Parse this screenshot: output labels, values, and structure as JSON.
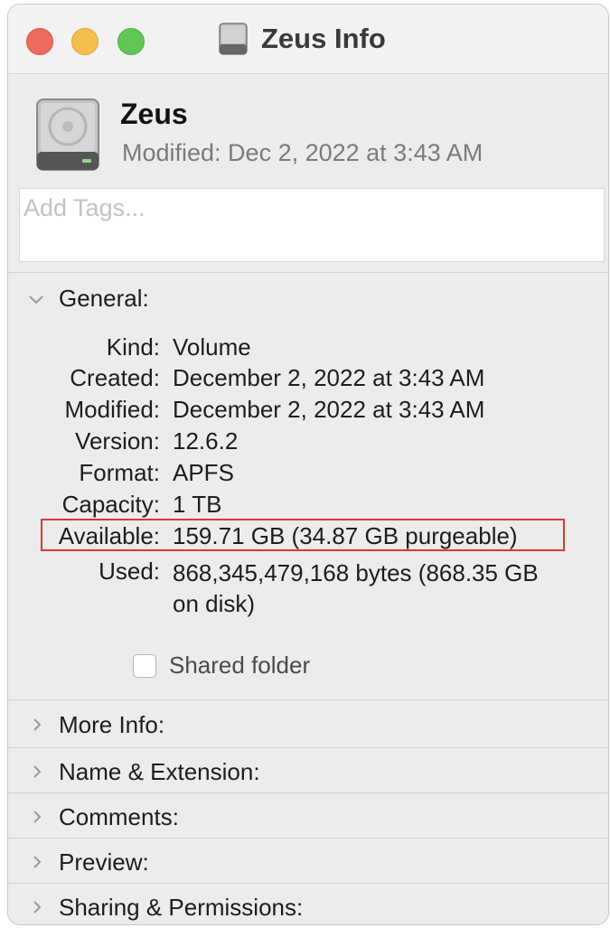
{
  "window": {
    "title": "Zeus Info",
    "icon": "hard-drive-icon"
  },
  "header": {
    "name": "Zeus",
    "modified": "Modified: Dec 2, 2022 at 3:43 AM"
  },
  "tags": {
    "placeholder": "Add Tags..."
  },
  "general": {
    "label": "General:",
    "rows": [
      {
        "key": "Kind:",
        "value": "Volume"
      },
      {
        "key": "Created:",
        "value": "December 2, 2022 at 3:43 AM"
      },
      {
        "key": "Modified:",
        "value": "December 2, 2022 at 3:43 AM"
      },
      {
        "key": "Version:",
        "value": "12.6.2"
      },
      {
        "key": "Format:",
        "value": "APFS"
      },
      {
        "key": "Capacity:",
        "value": "1 TB"
      },
      {
        "key": "Available:",
        "value": "159.71 GB (34.87 GB purgeable)"
      },
      {
        "key": "Used:",
        "value": "868,345,479,168 bytes (868.35 GB on disk)"
      }
    ],
    "shared_folder": {
      "label": "Shared folder",
      "checked": false
    }
  },
  "sections": [
    {
      "label": "More Info:"
    },
    {
      "label": "Name & Extension:"
    },
    {
      "label": "Comments:"
    },
    {
      "label": "Preview:"
    },
    {
      "label": "Sharing & Permissions:"
    }
  ],
  "colors": {
    "highlight_box": "#d93a2f",
    "close": "#ed6a5e",
    "minimize": "#f5bf4f",
    "zoom": "#62c655"
  }
}
